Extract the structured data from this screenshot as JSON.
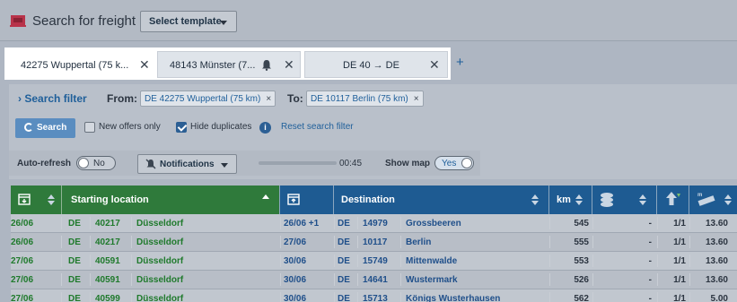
{
  "header": {
    "title": "Search for freight",
    "template_button": "Select template"
  },
  "tabs": [
    {
      "label": "42275 Wuppertal (75 k...",
      "close": "✕"
    },
    {
      "label": "48143 Münster (7...",
      "close": "✕"
    },
    {
      "label": "DE 40 → DE",
      "close": "✕"
    }
  ],
  "add_tab": "+",
  "filter": {
    "search_filter_link": "Search filter",
    "from_label": "From:",
    "from_value": "DE 42275 Wuppertal (75 km)",
    "to_label": "To:",
    "to_value": "DE 10117 Berlin (75 km)",
    "chip_close": "×",
    "search_button": "Search",
    "new_offers_label": "New offers only",
    "new_offers_checked": false,
    "hide_duplicates_label": "Hide duplicates",
    "hide_duplicates_checked": true,
    "info": "i",
    "reset_link": "Reset search filter"
  },
  "controls": {
    "auto_refresh_label": "Auto-refresh",
    "auto_refresh_value": "No",
    "notifications_button": "Notifications",
    "timer": "00:45",
    "show_map_label": "Show map",
    "show_map_value": "Yes"
  },
  "table": {
    "headers": {
      "starting_location": "Starting location",
      "destination": "Destination",
      "km": "km"
    },
    "colors": {
      "start_header": "#2f7a3b",
      "dest_header": "#1e5b92"
    },
    "rows": [
      {
        "start_date": "26/06",
        "start_country": "DE",
        "start_zip": "40217",
        "start_city": "Düsseldorf",
        "dest_date": "26/06 +1",
        "dest_country": "DE",
        "dest_zip": "14979",
        "dest_city": "Grossbeeren",
        "km": "545",
        "price": "-",
        "ratio": "1/1",
        "length": "13.60"
      },
      {
        "start_date": "26/06",
        "start_country": "DE",
        "start_zip": "40217",
        "start_city": "Düsseldorf",
        "dest_date": "27/06",
        "dest_country": "DE",
        "dest_zip": "10117",
        "dest_city": "Berlin",
        "km": "555",
        "price": "-",
        "ratio": "1/1",
        "length": "13.60"
      },
      {
        "start_date": "27/06",
        "start_country": "DE",
        "start_zip": "40591",
        "start_city": "Düsseldorf",
        "dest_date": "30/06",
        "dest_country": "DE",
        "dest_zip": "15749",
        "dest_city": "Mittenwalde",
        "km": "553",
        "price": "-",
        "ratio": "1/1",
        "length": "13.60"
      },
      {
        "start_date": "27/06",
        "start_country": "DE",
        "start_zip": "40591",
        "start_city": "Düsseldorf",
        "dest_date": "30/06",
        "dest_country": "DE",
        "dest_zip": "14641",
        "dest_city": "Wustermark",
        "km": "526",
        "price": "-",
        "ratio": "1/1",
        "length": "13.60"
      },
      {
        "start_date": "27/06",
        "start_country": "DE",
        "start_zip": "40599",
        "start_city": "Düsseldorf",
        "dest_date": "30/06",
        "dest_country": "DE",
        "dest_zip": "15713",
        "dest_city": "Königs Wusterhausen",
        "km": "562",
        "price": "-",
        "ratio": "1/1",
        "length": "5.00"
      }
    ]
  }
}
